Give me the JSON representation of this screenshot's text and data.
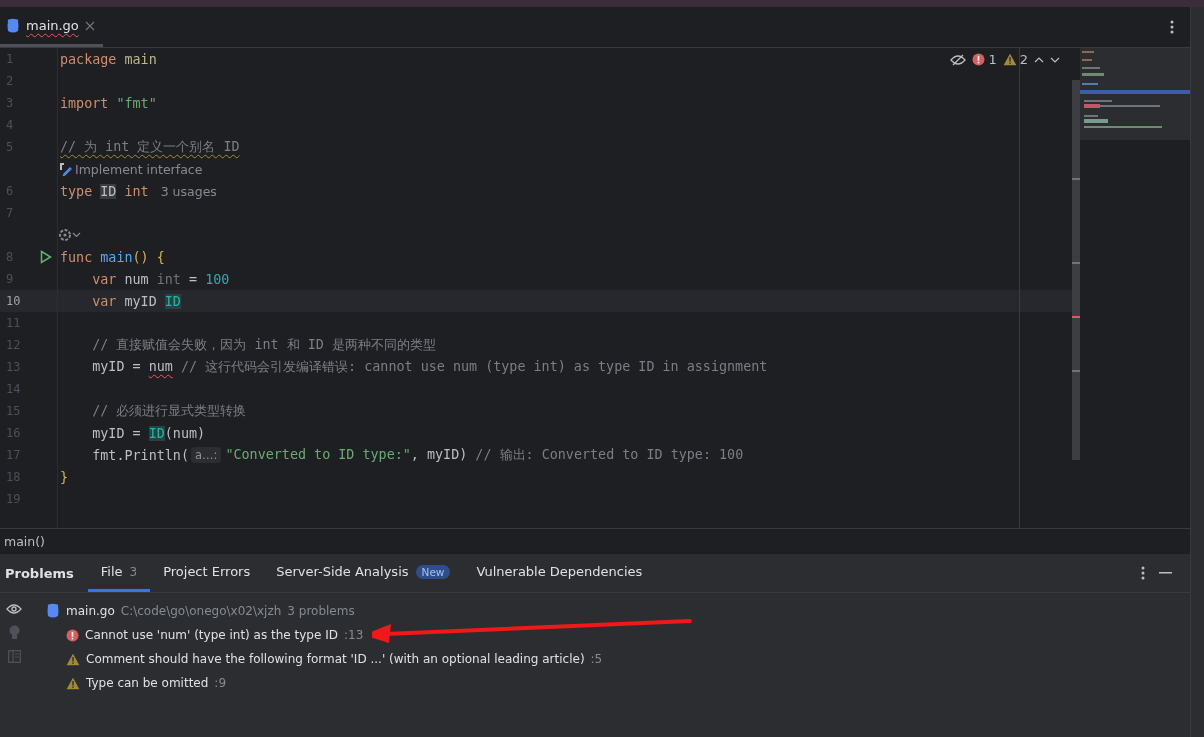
{
  "tab": {
    "title": "main.go",
    "selected": true
  },
  "inspections": {
    "errors": "1",
    "warnings": "2"
  },
  "code_lines": [
    {
      "kind": "code",
      "number": "1",
      "current": false,
      "run": false,
      "tokens": [
        {
          "text": "package",
          "kind": "kw"
        },
        {
          "text": " main",
          "kind": "pkg"
        }
      ]
    },
    {
      "kind": "code",
      "number": "2",
      "current": false,
      "run": false
    },
    {
      "kind": "code",
      "number": "3",
      "current": false,
      "run": false,
      "tokens": [
        {
          "text": "import",
          "kind": "kw"
        },
        {
          "text": " \"fmt\"",
          "kind": "str"
        }
      ]
    },
    {
      "kind": "code",
      "number": "4",
      "current": false,
      "run": false
    },
    {
      "kind": "code",
      "number": "5",
      "current": false,
      "run": false,
      "tokens": [
        {
          "text": "// 为 int 定义一个别名 ID",
          "kind": "cmt-warn"
        }
      ]
    },
    {
      "kind": "inlay",
      "text": "Implement interface"
    },
    {
      "kind": "code",
      "number": "6",
      "current": false,
      "run": false,
      "tokens": [
        {
          "text": "type ",
          "kind": "kw"
        },
        {
          "text": "ID",
          "kind": "typedef"
        },
        {
          "text": " int",
          "kind": "kw"
        },
        {
          "text": "3 usages",
          "kind": "usages"
        }
      ]
    },
    {
      "kind": "code",
      "number": "7",
      "current": false,
      "run": false
    },
    {
      "kind": "hint-icon"
    },
    {
      "kind": "code",
      "number": "8",
      "current": false,
      "run": true,
      "tokens": [
        {
          "text": "func",
          "kind": "kw"
        },
        {
          "text": " main",
          "kind": "fn"
        },
        {
          "text": "() {",
          "kind": "brace"
        }
      ]
    },
    {
      "kind": "code",
      "number": "9",
      "current": false,
      "run": false,
      "tokens": [
        {
          "text": "    var",
          "kind": "kw"
        },
        {
          "text": " num ",
          "kind": "plain"
        },
        {
          "text": "int",
          "kind": "dim"
        },
        {
          "text": " = ",
          "kind": "plain"
        },
        {
          "text": "100",
          "kind": "num"
        }
      ]
    },
    {
      "kind": "code",
      "number": "10",
      "current": true,
      "run": false,
      "tokens": [
        {
          "text": "    var",
          "kind": "kw"
        },
        {
          "text": " myID ",
          "kind": "plain"
        },
        {
          "text": "ID",
          "kind": "typeref"
        }
      ]
    },
    {
      "kind": "code",
      "number": "11",
      "current": false,
      "run": false
    },
    {
      "kind": "code",
      "number": "12",
      "current": false,
      "run": false,
      "tokens": [
        {
          "text": "    // 直接赋值会失败，因为 int 和 ID 是两种不同的类型",
          "kind": "cmt"
        }
      ]
    },
    {
      "kind": "code",
      "number": "13",
      "current": false,
      "run": false,
      "tokens": [
        {
          "text": "    myID = ",
          "kind": "plain"
        },
        {
          "text": "num",
          "kind": "err"
        },
        {
          "text": " // 这行代码会引发编译错误: cannot use num (type int) as type ID in assignment",
          "kind": "cmt"
        }
      ]
    },
    {
      "kind": "code",
      "number": "14",
      "current": false,
      "run": false
    },
    {
      "kind": "code",
      "number": "15",
      "current": false,
      "run": false,
      "tokens": [
        {
          "text": "    // 必须进行显式类型转换",
          "kind": "cmt"
        }
      ]
    },
    {
      "kind": "code",
      "number": "16",
      "current": false,
      "run": false,
      "tokens": [
        {
          "text": "    myID = ",
          "kind": "plain"
        },
        {
          "text": "ID",
          "kind": "typeref"
        },
        {
          "text": "(num)",
          "kind": "plain"
        }
      ]
    },
    {
      "kind": "code",
      "number": "17",
      "current": false,
      "run": false,
      "tokens": [
        {
          "text": "    fmt.Println(",
          "kind": "plain"
        },
        {
          "text": "a…:",
          "kind": "param"
        },
        {
          "text": "\"Converted to ID type:\"",
          "kind": "str"
        },
        {
          "text": ", myID) ",
          "kind": "plain"
        },
        {
          "text": "// 输出: Converted to ID type: 100",
          "kind": "cmt"
        }
      ]
    },
    {
      "kind": "code",
      "number": "18",
      "current": false,
      "run": false,
      "tokens": [
        {
          "text": "}",
          "kind": "brace"
        }
      ]
    },
    {
      "kind": "code",
      "number": "19",
      "current": false,
      "run": false
    }
  ],
  "breadcrumb": "main()",
  "problems": {
    "title": "Problems",
    "tabs": [
      {
        "label": "File",
        "count": "3",
        "selected": true
      },
      {
        "label": "Project Errors",
        "selected": false
      },
      {
        "label": "Server-Side Analysis",
        "badge": "New",
        "selected": false
      },
      {
        "label": "Vulnerable Dependencies",
        "selected": false
      }
    ],
    "file": {
      "name": "main.go",
      "path": "C:\\code\\go\\onego\\x02\\xjzh",
      "summary": "3 problems"
    },
    "items": [
      {
        "kind": "error",
        "message": "Cannot use 'num' (type int) as the type ID",
        "line": ":13"
      },
      {
        "kind": "warning",
        "message": "Comment should have the following format 'ID ...' (with an optional leading article)",
        "line": ":5"
      },
      {
        "kind": "warning",
        "message": "Type can be omitted",
        "line": ":9"
      }
    ]
  }
}
